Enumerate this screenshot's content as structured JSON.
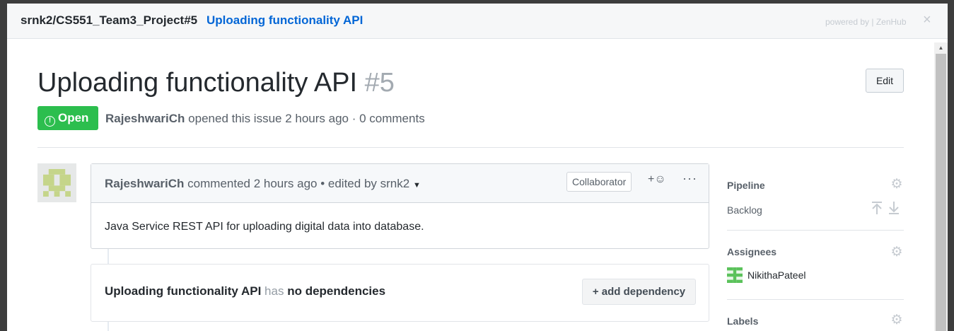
{
  "topbar": {
    "repo": "srnk2/CS551_Team3_Project#5",
    "title": "Uploading functionality API",
    "powered_by": "powered by | ZenHub",
    "close_icon": "×"
  },
  "issue": {
    "title": "Uploading functionality API",
    "number": "#5",
    "edit_label": "Edit",
    "state_label": "Open",
    "author": "RajeshwariCh",
    "opened_text": "opened this issue 2 hours ago · 0 comments"
  },
  "comment": {
    "author": "RajeshwariCh",
    "meta_text": "commented 2 hours ago • edited by srnk2",
    "badge": "Collaborator",
    "reaction_icon": "+☺",
    "more_icon": "···",
    "body": "Java Service REST API for uploading digital data into database."
  },
  "dependency": {
    "title": "Uploading functionality API",
    "has": "has",
    "status": "no dependencies",
    "button": "+ add dependency"
  },
  "sidebar": {
    "pipeline_label": "Pipeline",
    "pipeline_value": "Backlog",
    "assignees_label": "Assignees",
    "assignee_name": "NikithaPateel",
    "labels_label": "Labels"
  },
  "colors": {
    "open_green": "#2cbe4e",
    "link_blue": "#0366d6"
  }
}
